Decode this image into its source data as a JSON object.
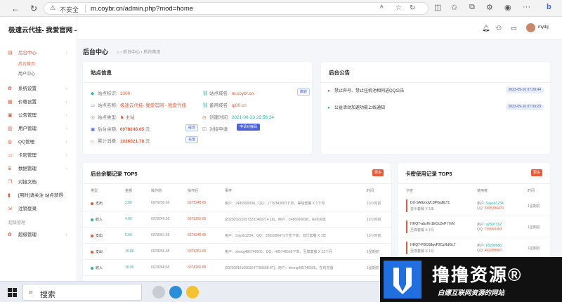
{
  "browser": {
    "insecure_label": "不安全",
    "url": "m.coybr.cn/admin.php?mod=home"
  },
  "sidebar": {
    "brand": "极速云代挂- 我爱官网 - 我",
    "menu": [
      {
        "label": "后台中心",
        "icon": "home-icon",
        "active": true,
        "subs": [
          {
            "label": "后台首页",
            "active": true
          },
          {
            "label": "用户中心",
            "active": false
          }
        ]
      },
      {
        "label": "系统设置",
        "icon": "gear-icon"
      },
      {
        "label": "价格设置",
        "icon": "price-icon"
      },
      {
        "label": "公告管理",
        "icon": "notice-icon"
      },
      {
        "label": "用户管理",
        "icon": "user-icon"
      },
      {
        "label": "QQ管理",
        "icon": "qq-icon"
      },
      {
        "label": "卡密管理",
        "icon": "card-icon"
      },
      {
        "label": "数据管理",
        "icon": "data-icon"
      },
      {
        "label": "对接文档",
        "icon": "doc-icon"
      },
      {
        "label": "[用时]请关注 站点获得",
        "icon": "timer-icon"
      },
      {
        "label": "注销登录",
        "icon": "logout-icon"
      }
    ],
    "section_caption": "超级管理",
    "super_item": "超级管理"
  },
  "topbar": {
    "username": "mydg"
  },
  "breadcrumb": {
    "title": "后台中心",
    "items": [
      "后台中心",
      "后台首页"
    ]
  },
  "site_info": {
    "title": "站点信息",
    "site_id_label": "站点标识:",
    "site_id": "1000",
    "site_name_label": "站点名称:",
    "site_name": "极速云代挂- 我爱官网 - 我爱代挂",
    "site_type_label": "站点类型:",
    "site_type": "主站",
    "balance_label": "后台余额:",
    "balance": "6978248.65",
    "balance_unit": "元",
    "consume_label": "累计消费:",
    "consume": "1026021.78",
    "consume_unit": "元",
    "domain_label": "站点域名:",
    "domain": "m.coybr.cn",
    "domain_btn": "跳转",
    "backup_label": "备用域名:",
    "backup": "qj00.cn",
    "created_label": "创建时间:",
    "created": "2021-08-23 22:56:34",
    "apply_label": "对接申请:",
    "apply_btn": "申请对接码",
    "recharge_btn": "提现",
    "detail_btn": "充值"
  },
  "notices": {
    "title": "后台公告",
    "items": [
      {
        "text": "禁止奔号、禁止挂机池相同进QQ公告",
        "date": "2023-09-10 07:28:44"
      },
      {
        "text": "公益活动加速功能上线通知",
        "date": "2023-09-10 07:39:29"
      }
    ]
  },
  "balance_records": {
    "title": "后台余额记录 TOP5",
    "more": "更多",
    "headers": [
      "类型",
      "金额",
      "操作前",
      "操作后",
      "事件",
      "时间"
    ],
    "rows": [
      {
        "type": "支出",
        "amount": "2.00",
        "before": "6978250.65",
        "after": "6978248.65",
        "event": "用户：2486990098，QQ：1779343803下单，等级套餐 X 1个月",
        "time": "10小时前"
      },
      {
        "type": "收入",
        "amount": "4.00",
        "before": "6978246.65",
        "after": "6978250.65",
        "event": "[2023092216573291400714 18]，用户：2486990098，在线充值",
        "time": "10小时前"
      },
      {
        "type": "支出",
        "amount": "5.00",
        "before": "6978251.65",
        "after": "6978246.65",
        "event": "用户：Saysb1234，QQ：3305286471卡密下单，音乐套餐 X 1年",
        "time": "10小时前"
      },
      {
        "type": "支出",
        "amount": "15.00",
        "before": "6978266.65",
        "after": "6978251.65",
        "event": "用户：zheng485746565，QQ：485746565下单，至尊套餐 X 12个月",
        "time": "1星期前"
      },
      {
        "type": "收入",
        "amount": "18.00",
        "before": "6978248.65",
        "after": "6978266.65",
        "event": "[2023081510552647790568 87]，用户：zheng485746565，在线充值",
        "time": "1星期前"
      }
    ]
  },
  "card_records": {
    "title": "卡密使用记录 TOP5",
    "more": "更多",
    "headers": [
      "卡密",
      "使用者",
      "时间"
    ],
    "rows": [
      {
        "code": "DX-SAfUoqVL8PGaBLT1",
        "sub": "音乐套餐 X 1年",
        "user": "Saysb1234",
        "qq": "3305286471",
        "time": "1星期前"
      },
      {
        "code": "HHQT-abxHn1EOc2eP f7vN",
        "sub": "至尊套餐 X 1月",
        "user": "a2507162",
        "qq": "739900283",
        "time": "1星期前"
      },
      {
        "code": "HHQT-FBO38qvP2CzRdGLT",
        "sub": "至尊套餐 X 1月",
        "user": "b5299986",
        "qq": "462288807",
        "time": "1星期前"
      }
    ]
  },
  "taskbar": {
    "search_label": "搜索"
  },
  "watermark": {
    "big": "撸撸资源®",
    "small": "白嫖互联网资源的网站"
  }
}
